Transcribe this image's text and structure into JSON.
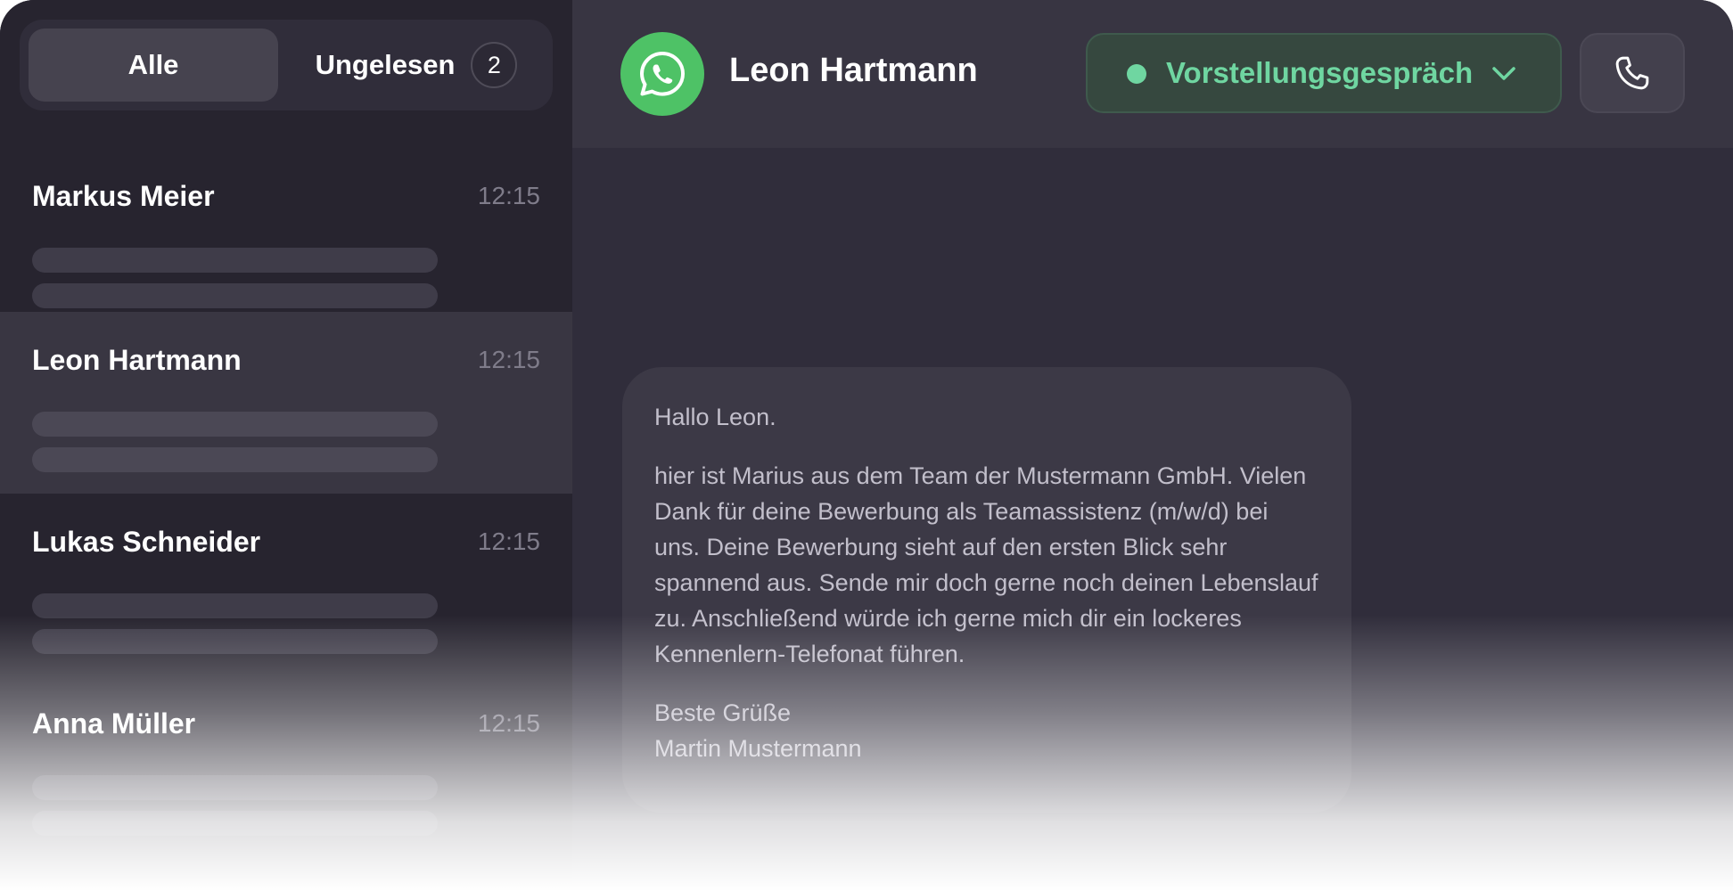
{
  "filters": {
    "all_label": "Alle",
    "unread_label": "Ungelesen",
    "unread_count": "2"
  },
  "chats": [
    {
      "name": "Markus Meier",
      "time": "12:15",
      "active": false
    },
    {
      "name": "Leon Hartmann",
      "time": "12:15",
      "active": true
    },
    {
      "name": "Lukas Schneider",
      "time": "12:15",
      "active": false
    },
    {
      "name": "Anna Müller",
      "time": "12:15",
      "active": false
    }
  ],
  "header": {
    "channel_icon": "whatsapp-icon",
    "contact_name": "Leon Hartmann",
    "status_label": "Vorstellungsgespräch",
    "status_color": "#6fd6a1",
    "call_icon": "phone-icon"
  },
  "message": {
    "greeting": "Hallo Leon.",
    "body": "hier ist Marius aus dem Team der Mustermann GmbH. Vielen Dank für deine Bewerbung als Teamassistenz (m/w/d) bei uns. Deine Bewerbung sieht auf den ersten Blick sehr spannend aus. Sende mir doch gerne noch deinen Lebenslauf zu. Anschließend würde ich gerne mich dir ein lockeres Kennenlern-Telefonat führen.",
    "closing": "Beste Grüße",
    "signature": "Martin Mustermann"
  }
}
